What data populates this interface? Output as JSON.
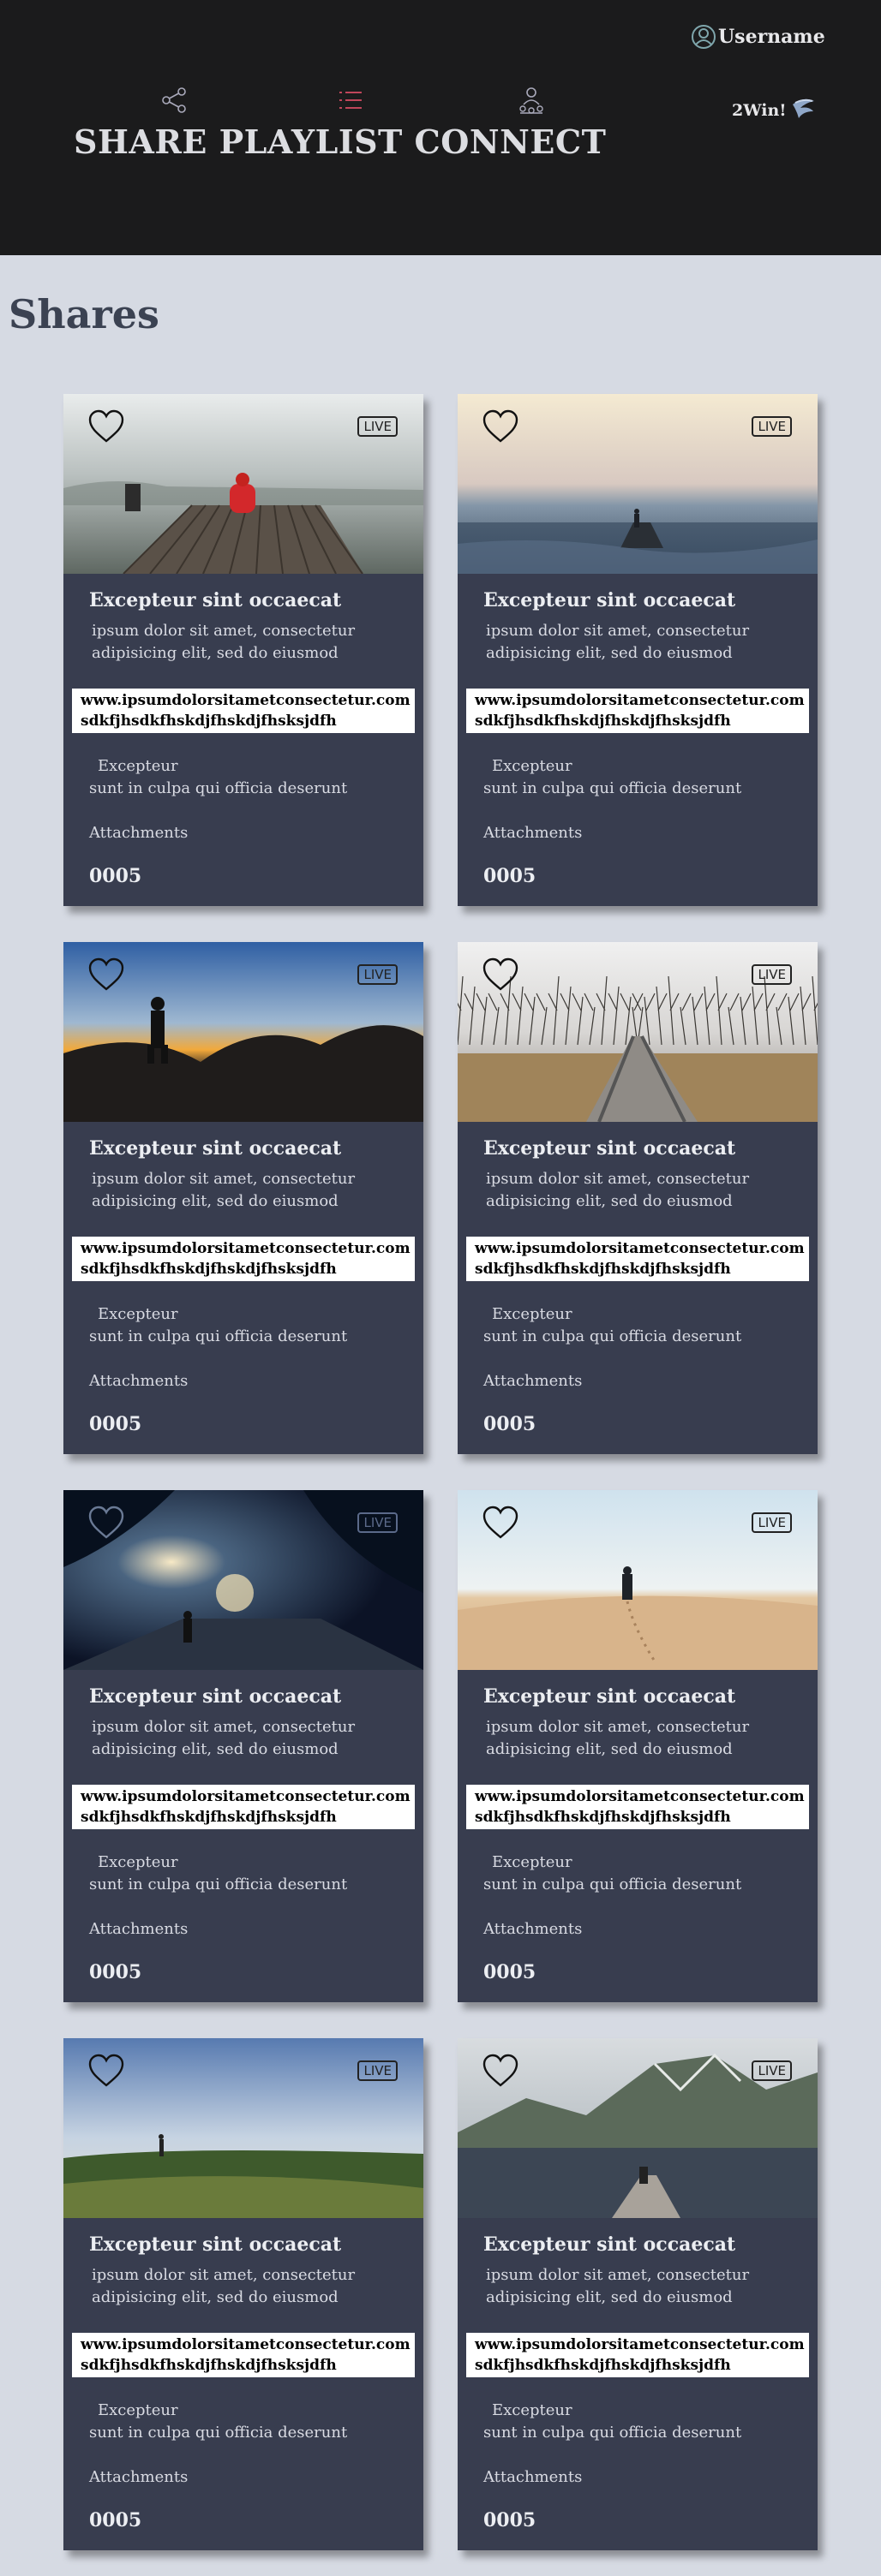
{
  "header": {
    "brand": "SHARE PLAYLIST CONNECT",
    "username": "Username",
    "win_label": "2Win!",
    "nav_icons": [
      "share-icon",
      "list-icon",
      "connect-icon"
    ],
    "accent_color": "#c0465a"
  },
  "section": {
    "title": "Shares"
  },
  "cards": [
    {
      "title": "Excepteur sint occaecat",
      "desc": "ipsum dolor sit amet, consectetur adipisicing elit, sed do eiusmod",
      "url": "www.ipsumdolorsitametconsectetur.com sdkfjhsdkfhskdjfhskdjfhsksjdfh",
      "sub1": "Excepteur",
      "sub2": "sunt in culpa qui officia deserunt",
      "attach": "Attachments",
      "count": "0005",
      "live": "LIVE",
      "scene": "dock"
    },
    {
      "title": "Excepteur sint occaecat",
      "desc": "ipsum dolor sit amet, consectetur adipisicing elit, sed do eiusmod",
      "url": "www.ipsumdolorsitametconsectetur.com sdkfjhsdkfhskdjfhskdjfhsksjdfh",
      "sub1": "Excepteur",
      "sub2": "sunt in culpa qui officia deserunt",
      "attach": "Attachments",
      "count": "0005",
      "live": "LIVE",
      "scene": "sea"
    },
    {
      "title": "Excepteur sint occaecat",
      "desc": "ipsum dolor sit amet, consectetur adipisicing elit, sed do eiusmod",
      "url": "www.ipsumdolorsitametconsectetur.com sdkfjhsdkfhskdjfhskdjfhsksjdfh",
      "sub1": "Excepteur",
      "sub2": "sunt in culpa qui officia deserunt",
      "attach": "Attachments",
      "count": "0005",
      "live": "LIVE",
      "scene": "sunset"
    },
    {
      "title": "Excepteur sint occaecat",
      "desc": "ipsum dolor sit amet, consectetur adipisicing elit, sed do eiusmod",
      "url": "www.ipsumdolorsitametconsectetur.com sdkfjhsdkfhskdjfhskdjfhsksjdfh",
      "sub1": "Excepteur",
      "sub2": "sunt in culpa qui officia deserunt",
      "attach": "Attachments",
      "count": "0005",
      "live": "LIVE",
      "scene": "rails"
    },
    {
      "title": "Excepteur sint occaecat",
      "desc": "ipsum dolor sit amet, consectetur adipisicing elit, sed do eiusmod",
      "url": "www.ipsumdolorsitametconsectetur.com sdkfjhsdkfhskdjfhskdjfhsksjdfh",
      "sub1": "Excepteur",
      "sub2": "sunt in culpa qui officia deserunt",
      "attach": "Attachments",
      "count": "0005",
      "live": "LIVE",
      "scene": "night"
    },
    {
      "title": "Excepteur sint occaecat",
      "desc": "ipsum dolor sit amet, consectetur adipisicing elit, sed do eiusmod",
      "url": "www.ipsumdolorsitametconsectetur.com sdkfjhsdkfhskdjfhskdjfhsksjdfh",
      "sub1": "Excepteur",
      "sub2": "sunt in culpa qui officia deserunt",
      "attach": "Attachments",
      "count": "0005",
      "live": "LIVE",
      "scene": "desert"
    },
    {
      "title": "Excepteur sint occaecat",
      "desc": "ipsum dolor sit amet, consectetur adipisicing elit, sed do eiusmod",
      "url": "www.ipsumdolorsitametconsectetur.com sdkfjhsdkfhskdjfhskdjfhsksjdfh",
      "sub1": "Excepteur",
      "sub2": "sunt in culpa qui officia deserunt",
      "attach": "Attachments",
      "count": "0005",
      "live": "LIVE",
      "scene": "meadow"
    },
    {
      "title": "Excepteur sint occaecat",
      "desc": "ipsum dolor sit amet, consectetur adipisicing elit, sed do eiusmod",
      "url": "www.ipsumdolorsitametconsectetur.com sdkfjhsdkfhskdjfhskdjfhsksjdfh",
      "sub1": "Excepteur",
      "sub2": "sunt in culpa qui officia deserunt",
      "attach": "Attachments",
      "count": "0005",
      "live": "LIVE",
      "scene": "lake"
    }
  ]
}
